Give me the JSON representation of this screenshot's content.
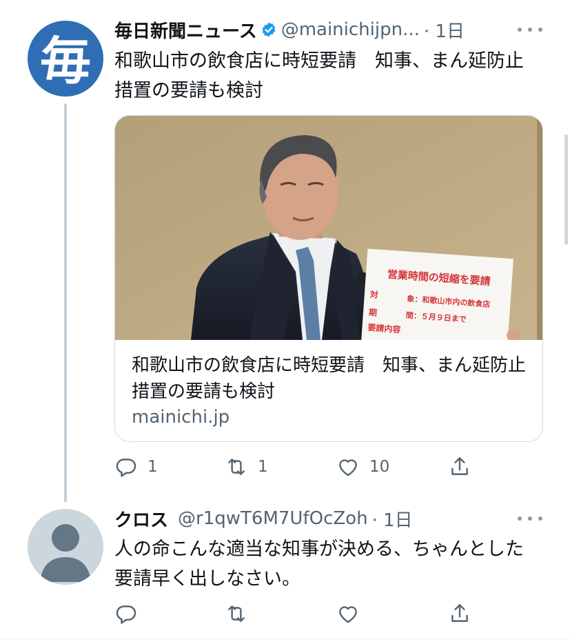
{
  "tweets": [
    {
      "display_name": "毎日新聞ニュース",
      "handle": "@mainichijpn...",
      "time": "· 1日",
      "verified": true,
      "avatar_label": "毎",
      "text": "和歌山市の飲食店に時短要請　知事、まん延防止措置の要請も検討",
      "card": {
        "title": "和歌山市の飲食店に時短要請　知事、まん延防止措置の要請も検討",
        "domain": "mainichi.jp",
        "sign": {
          "heading": "営業時間の短縮を要請",
          "row1_label": "対",
          "row1_value": "象：和歌山市内の飲食店",
          "row2_label": "期",
          "row2_value": "間：５月９日まで",
          "row3_label": "要請内容"
        }
      },
      "actions": {
        "reply": "1",
        "retweet": "1",
        "like": "10"
      }
    },
    {
      "display_name": "クロス",
      "handle": "@r1qwT6M7UfOcZoh",
      "time": "· 1日",
      "verified": false,
      "text": "人の命こんな適当な知事が決める、ちゃんとした要請早く出しなさい。",
      "actions": {
        "reply": "",
        "retweet": "",
        "like": ""
      }
    }
  ],
  "colors": {
    "accent": "#1d9bf0",
    "secondary_text": "#536471",
    "mainichi_blue": "#2f6eb5"
  },
  "icons": [
    "reply-icon",
    "retweet-icon",
    "like-icon",
    "share-icon",
    "verified-badge-icon",
    "more-icon"
  ]
}
